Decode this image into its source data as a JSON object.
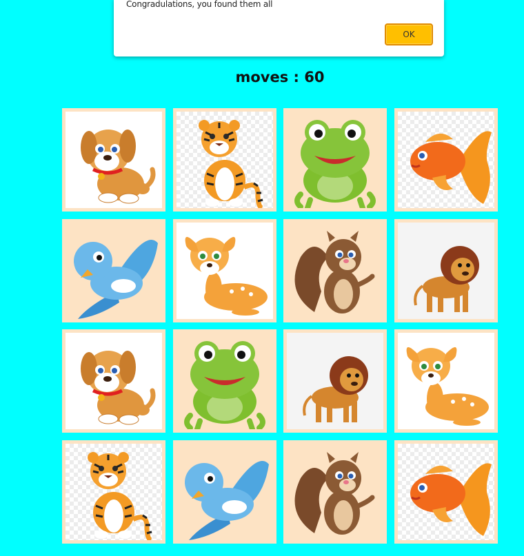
{
  "alert": {
    "message": "Congradulations, you found them all",
    "ok_label": "OK"
  },
  "moves": {
    "text": "moves : 60",
    "count": 60
  },
  "colors": {
    "background": "#00ffff",
    "card_border": "#fde3c4",
    "ok_button": "#ffbf00"
  },
  "board": {
    "cards": [
      {
        "animal": "puppy-icon"
      },
      {
        "animal": "tiger-icon"
      },
      {
        "animal": "frog-icon"
      },
      {
        "animal": "goldfish-icon"
      },
      {
        "animal": "bluebird-icon"
      },
      {
        "animal": "fawn-icon"
      },
      {
        "animal": "squirrel-icon"
      },
      {
        "animal": "lion-icon"
      },
      {
        "animal": "puppy-icon"
      },
      {
        "animal": "frog-icon"
      },
      {
        "animal": "lion-icon"
      },
      {
        "animal": "fawn-icon"
      },
      {
        "animal": "tiger-icon"
      },
      {
        "animal": "bluebird-icon"
      },
      {
        "animal": "squirrel-icon"
      },
      {
        "animal": "goldfish-icon"
      }
    ]
  }
}
